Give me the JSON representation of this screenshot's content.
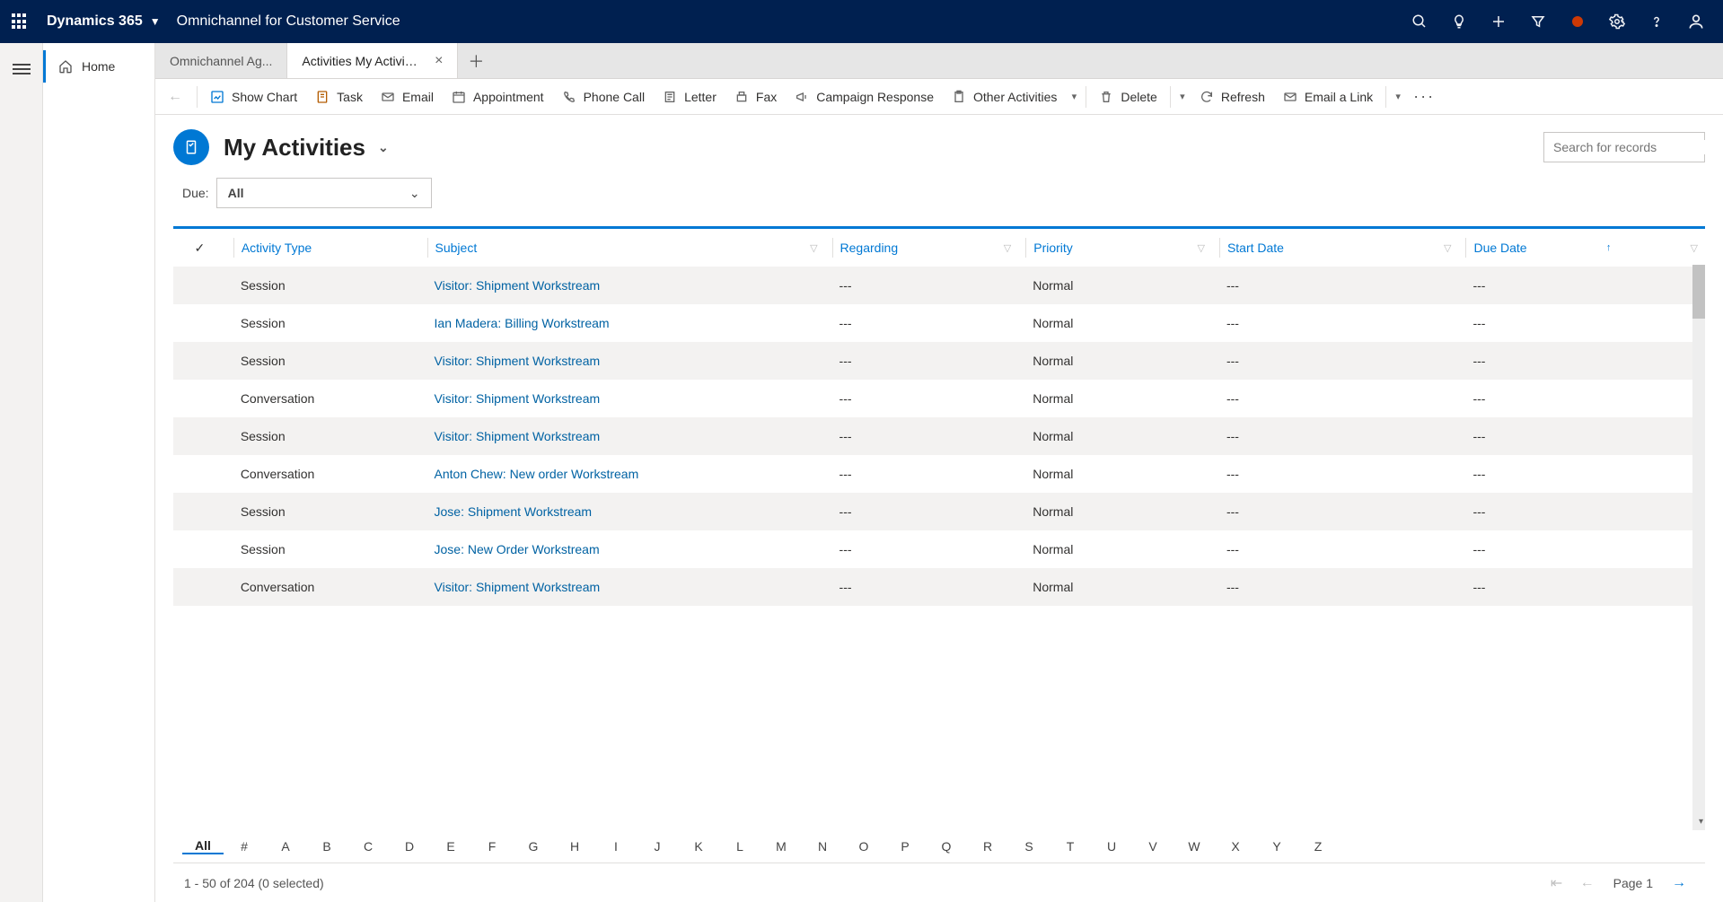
{
  "header": {
    "product": "Dynamics 365",
    "module": "Omnichannel for Customer Service"
  },
  "sidebar": {
    "home": "Home"
  },
  "tabs": [
    {
      "label": "Omnichannel Ag...",
      "active": false,
      "closable": false
    },
    {
      "label": "Activities My Activities",
      "active": true,
      "closable": true
    }
  ],
  "toolbar": {
    "back": "Back",
    "show_chart": "Show Chart",
    "task": "Task",
    "email": "Email",
    "appointment": "Appointment",
    "phone_call": "Phone Call",
    "letter": "Letter",
    "fax": "Fax",
    "campaign_response": "Campaign Response",
    "other_activities": "Other Activities",
    "delete": "Delete",
    "refresh": "Refresh",
    "email_link": "Email a Link"
  },
  "page": {
    "title": "My Activities",
    "search_placeholder": "Search for records"
  },
  "filters": {
    "due_label": "Due:",
    "due_value": "All"
  },
  "columns": {
    "activity_type": "Activity Type",
    "subject": "Subject",
    "regarding": "Regarding",
    "priority": "Priority",
    "start_date": "Start Date",
    "due_date": "Due Date"
  },
  "rows": [
    {
      "type": "Session",
      "subject": "Visitor: Shipment Workstream",
      "regarding": "---",
      "priority": "Normal",
      "start": "---",
      "due": "---"
    },
    {
      "type": "Session",
      "subject": "Ian Madera: Billing Workstream",
      "regarding": "---",
      "priority": "Normal",
      "start": "---",
      "due": "---"
    },
    {
      "type": "Session",
      "subject": "Visitor: Shipment Workstream",
      "regarding": "---",
      "priority": "Normal",
      "start": "---",
      "due": "---"
    },
    {
      "type": "Conversation",
      "subject": "Visitor: Shipment Workstream",
      "regarding": "---",
      "priority": "Normal",
      "start": "---",
      "due": "---"
    },
    {
      "type": "Session",
      "subject": "Visitor: Shipment Workstream",
      "regarding": "---",
      "priority": "Normal",
      "start": "---",
      "due": "---"
    },
    {
      "type": "Conversation",
      "subject": "Anton Chew: New order Workstream",
      "regarding": "---",
      "priority": "Normal",
      "start": "---",
      "due": "---"
    },
    {
      "type": "Session",
      "subject": "Jose: Shipment Workstream",
      "regarding": "---",
      "priority": "Normal",
      "start": "---",
      "due": "---"
    },
    {
      "type": "Session",
      "subject": "Jose: New Order Workstream",
      "regarding": "---",
      "priority": "Normal",
      "start": "---",
      "due": "---"
    },
    {
      "type": "Conversation",
      "subject": "Visitor: Shipment Workstream",
      "regarding": "---",
      "priority": "Normal",
      "start": "---",
      "due": "---"
    }
  ],
  "alpha_filter": [
    "All",
    "#",
    "A",
    "B",
    "C",
    "D",
    "E",
    "F",
    "G",
    "H",
    "I",
    "J",
    "K",
    "L",
    "M",
    "N",
    "O",
    "P",
    "Q",
    "R",
    "S",
    "T",
    "U",
    "V",
    "W",
    "X",
    "Y",
    "Z"
  ],
  "alpha_selected": "All",
  "footer": {
    "status": "1 - 50 of 204 (0 selected)",
    "page_label": "Page 1"
  }
}
